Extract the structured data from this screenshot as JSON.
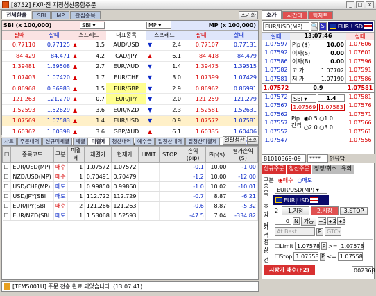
{
  "window": {
    "title": "[8752] FX마진 지정청산종합주문"
  },
  "main_tabs": [
    "전체환율",
    "SBI",
    "MP",
    "관심종목"
  ],
  "clear_btn": "초기화",
  "rate_header": {
    "left_source": "SBI (x 100,000)",
    "left_select": "SBI",
    "right_source": "MP (x 100,000)",
    "right_select": "MP",
    "col_sell": "팔때",
    "col_buy": "살때",
    "col_spread": "스프레드",
    "col_symbol": "대표종목"
  },
  "rates": [
    {
      "l_sell": "0.77110",
      "l_buy": "0.77125",
      "l_arrow": "▲",
      "l_spread": "1.5",
      "symbol": "AUD/USD",
      "r_arrow": "▼",
      "r_spread": "2.4",
      "r_sell": "0.77107",
      "r_buy": "0.77131",
      "hl": ""
    },
    {
      "l_sell": "84.429",
      "l_buy": "84.471",
      "l_arrow": "▲",
      "l_spread": "4.2",
      "symbol": "CAD/JPY",
      "r_arrow": "▲",
      "r_spread": "6.1",
      "r_sell": "84.418",
      "r_buy": "84.479",
      "hl": ""
    },
    {
      "l_sell": "1.39481",
      "l_buy": "1.39508",
      "l_arrow": "▲",
      "l_spread": "2.7",
      "symbol": "EUR/AUD",
      "r_arrow": "▼",
      "r_spread": "1.4",
      "r_sell": "1.39475",
      "r_buy": "1.39515",
      "hl": ""
    },
    {
      "l_sell": "1.07403",
      "l_buy": "1.07420",
      "l_arrow": "▲",
      "l_spread": "1.7",
      "symbol": "EUR/CHF",
      "r_arrow": "▼",
      "r_spread": "3.0",
      "r_sell": "1.07399",
      "r_buy": "1.07429",
      "hl": ""
    },
    {
      "l_sell": "0.86968",
      "l_buy": "0.86983",
      "l_arrow": "▲",
      "l_spread": "1.5",
      "symbol": "EUR/GBP",
      "r_arrow": "▼",
      "r_spread": "2.9",
      "r_sell": "0.86962",
      "r_buy": "0.86991",
      "hl": "yellow"
    },
    {
      "l_sell": "121.263",
      "l_buy": "121.270",
      "l_arrow": "▲",
      "l_spread": "0.7",
      "symbol": "EUR/JPY",
      "r_arrow": "▼",
      "r_spread": "2.0",
      "r_sell": "121.259",
      "r_buy": "121.279",
      "hl": "yellow"
    },
    {
      "l_sell": "1.52593",
      "l_buy": "1.52629",
      "l_arrow": "▲",
      "l_spread": "3.6",
      "symbol": "EUR/NZD",
      "r_arrow": "▼",
      "r_spread": "2.3",
      "r_sell": "1.52581",
      "r_buy": "1.52631",
      "hl": ""
    },
    {
      "l_sell": "1.07569",
      "l_buy": "1.07583",
      "l_arrow": "▲",
      "l_spread": "1.4",
      "symbol": "EUR/USD",
      "r_arrow": "▼",
      "r_spread": "0.9",
      "r_sell": "1.07572",
      "r_buy": "1.07581",
      "hl": "sel"
    },
    {
      "l_sell": "1.60362",
      "l_buy": "1.60398",
      "l_arrow": "▲",
      "l_spread": "3.6",
      "symbol": "GBP/AUD",
      "r_arrow": "▲",
      "r_spread": "6.1",
      "r_sell": "1.60335",
      "r_buy": "1.60406",
      "hl": ""
    },
    {
      "l_sell": "1.23482",
      "l_buy": "1.23514",
      "l_arrow": "▲",
      "l_spread": "3.2",
      "symbol": "GBP/CAD",
      "r_arrow": "▲",
      "r_spread": "4.5",
      "r_sell": "1.23474",
      "r_buy": "1.23519",
      "hl": ""
    }
  ],
  "sub_tabs": [
    "차트",
    "주문내역",
    "신규미체결",
    "체결",
    "미결제",
    "청산내역",
    "예수금",
    "일청산내역",
    "일청산미결제"
  ],
  "sub_active": 4,
  "bulk_close_btn": "일괄청산",
  "lookup_btn": "조회",
  "order_cols": [
    "종목코드",
    "구분",
    "미결제",
    "체결가",
    "현재가",
    "LIMIT",
    "STOP",
    "손익(pip)",
    "Pip($)",
    "평가손익($)"
  ],
  "orders": [
    {
      "code": "EUR/USD(MP)",
      "side": "매수",
      "qty": "1",
      "fill": "1.07572",
      "cur": "1.07572",
      "limit": "",
      "stop": "",
      "pl_pip": "-0.1",
      "pip": "10.00",
      "pl": "-1.00"
    },
    {
      "code": "NZD/USD(MP)",
      "side": "매수",
      "qty": "1",
      "fill": "0.70491",
      "cur": "0.70479",
      "limit": "",
      "stop": "",
      "pl_pip": "-1.2",
      "pip": "10.00",
      "pl": "-12.00"
    },
    {
      "code": "USD/CHF(MP)",
      "side": "매도",
      "qty": "1",
      "fill": "0.99850",
      "cur": "0.99860",
      "limit": "",
      "stop": "",
      "pl_pip": "-1.0",
      "pip": "10.02",
      "pl": "-10.01"
    },
    {
      "code": "USD/JPY(SBI",
      "side": "매도",
      "qty": "1",
      "fill": "112.722",
      "cur": "112.729",
      "limit": "",
      "stop": "",
      "pl_pip": "-0.7",
      "pip": "8.87",
      "pl": "-6.21"
    },
    {
      "code": "EUR/JPY(SBI",
      "side": "매수",
      "qty": "2",
      "fill": "121.266",
      "cur": "121.263",
      "limit": "",
      "stop": "",
      "pl_pip": "-0.6",
      "pip": "8.87",
      "pl": "-5.32"
    },
    {
      "code": "EUR/NZD(SBI",
      "side": "매도",
      "qty": "1",
      "fill": "1.53068",
      "cur": "1.52593",
      "limit": "",
      "stop": "",
      "pl_pip": "-47.5",
      "pip": "7.04",
      "pl": "-334.82"
    }
  ],
  "status_msg": "[TFM5001U] 주문 전송 완료 되었습니다. (13:07:41)",
  "right_tabs": [
    "호가",
    "시간대",
    "틱차트"
  ],
  "quote": {
    "symbol": "EUR/USD(MP)",
    "s_btn": "S",
    "pair_label": "EUR|USD",
    "col_buy": "살때",
    "time": "13:07:46",
    "col_sell": "상때"
  },
  "ask_ladder": [
    "1.07597",
    "1.07592",
    "1.07586",
    "1.07582",
    "1.07581"
  ],
  "bid_ladder": [
    "1.07572",
    "1.07567",
    "1.07562",
    "1.07557",
    "1.07552",
    "1.07547"
  ],
  "ask_ladder_right": [
    "1.07606",
    "1.07601",
    "1.07596",
    "1.07591",
    "1.07586"
  ],
  "bid_ladder_right": [
    "1.07581",
    "1.07576",
    "1.07571",
    "1.07566",
    "1.07561",
    "1.07556"
  ],
  "info": {
    "pip_label": "Pip ($)",
    "pip": "10.00",
    "swap_a_label": "이자(S)",
    "swap_a": "0.00",
    "swap_b_label": "이자(B)",
    "swap_b": "0.00",
    "high_label": "고 가",
    "high": "1.07702",
    "low_label": "저 가",
    "low": "1.07190"
  },
  "center": {
    "bid": "1.07572",
    "spread": "0.9",
    "ask": "1.07581"
  },
  "mini": {
    "src": "SBI",
    "spread": "1.4",
    "bid": "1.07569",
    "ask": "1.07583"
  },
  "pip_gap": {
    "label": "Pip 간격",
    "opt1": "0.5",
    "opt2": "1.0",
    "opt3": "2.0",
    "opt4": "3.0"
  },
  "account": {
    "number": "81010369-09",
    "pwd": "****",
    "name": "인유담"
  },
  "order_tabs": [
    "신규주문",
    "청산주문",
    "정정/취소",
    "유의"
  ],
  "order_form": {
    "side_label": "구분",
    "buy": "매수",
    "sell": "매도",
    "symbol_label": "종목",
    "symbol": "EUR/USD(MP)",
    "pair": "EUR|USD",
    "hoga_label": "호가",
    "hoga_qty": "2",
    "hoga1": "1.지정",
    "hoga2": "2.시장",
    "hoga3": "3.STOP",
    "qty_label": "수량",
    "qty": "0",
    "n_btn": "N",
    "avail_label": "가능",
    "qty_inc": [
      "+1",
      "+2",
      "+3"
    ],
    "price_label": "가격",
    "price": "At Best",
    "p_btn": "P",
    "gtc": "GTC",
    "close_label": "청산",
    "limit_label": "Limit",
    "limit_val": "1.07578",
    "limit_res": "1.07578",
    "cond_label": "조건",
    "stop_label": "Stop",
    "stop_val": "1.07558",
    "stop_res": "1.07558",
    "submit": "시장가 매수(F2)",
    "code": "002368"
  }
}
